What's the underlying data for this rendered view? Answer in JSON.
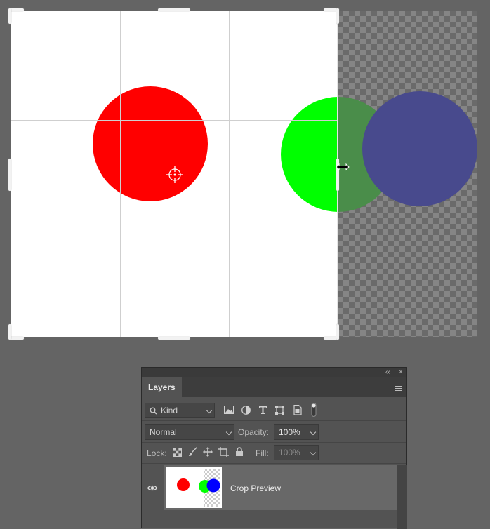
{
  "canvas": {
    "shapes": [
      {
        "name": "red-circle",
        "color": "#ff0000"
      },
      {
        "name": "green-circle",
        "color": "#00ff00"
      },
      {
        "name": "green-circle-dimmed",
        "color": "#4a8d4a"
      },
      {
        "name": "blue-circle-dimmed",
        "color": "#484a8d"
      }
    ],
    "colors": {
      "canvas_bg": "#ffffff",
      "workspace_bg": "#646464",
      "grid": "#cfcfcf"
    }
  },
  "layers_panel": {
    "collapse_label": "‹‹",
    "close_label": "×",
    "tab_label": "Layers",
    "filter": {
      "placeholder": "Kind",
      "icons": [
        "image-icon",
        "adjustment-icon",
        "type-icon",
        "shape-icon",
        "smart-object-icon",
        "filter-toggle-icon"
      ]
    },
    "blend_mode": "Normal",
    "opacity_label": "Opacity:",
    "opacity_value": "100%",
    "lock_label": "Lock:",
    "fill_label": "Fill:",
    "fill_value": "100%",
    "layers": [
      {
        "name": "Crop Preview",
        "visible": true
      }
    ]
  }
}
